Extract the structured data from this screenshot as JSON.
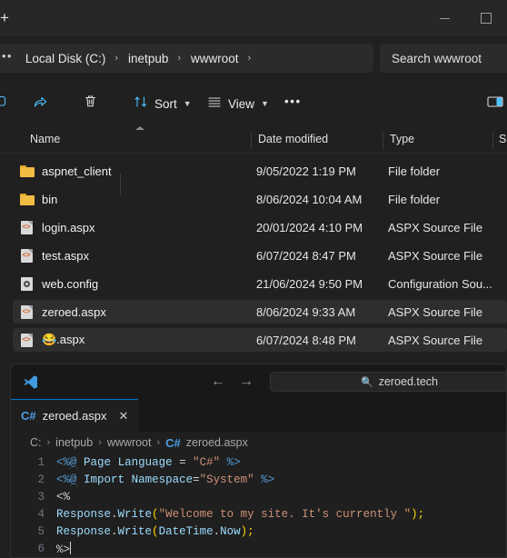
{
  "colors": {
    "accent": "#0078d4",
    "explorer_bg": "#202020",
    "titlebar_bg": "#272727",
    "vscode_bg": "#1f1f1f",
    "selected_row": "#2e2e2e",
    "folder_yellow": "#f2bb42",
    "aspx_orange": "#d4622a"
  },
  "explorer": {
    "titlebar": {
      "new_tab_label": "+",
      "minimize_label": "minimize",
      "maximize_label": "maximize"
    },
    "address_bar": {
      "overflow_label": "•••",
      "crumbs": [
        {
          "label": "Local Disk (C:)"
        },
        {
          "label": "inetpub"
        },
        {
          "label": "wwwroot"
        }
      ],
      "separator": "›",
      "trailing_separator": "›"
    },
    "search": {
      "value": "Search wwwroot",
      "placeholder": "Search wwwroot"
    },
    "toolbar": {
      "items": [
        {
          "name": "rename-button",
          "label": ""
        },
        {
          "name": "share-button",
          "label": ""
        },
        {
          "name": "delete-button",
          "label": ""
        },
        {
          "name": "sort-button",
          "label": "Sort"
        },
        {
          "name": "view-button",
          "label": "View"
        },
        {
          "name": "more-button",
          "label": "•••"
        },
        {
          "name": "details-pane-button",
          "label": ""
        }
      ],
      "sort_label": "Sort",
      "view_label": "View",
      "more_label": "•••"
    },
    "columns": [
      {
        "key": "name",
        "label": "Name",
        "sorted": "asc"
      },
      {
        "key": "date",
        "label": "Date modified"
      },
      {
        "key": "type",
        "label": "Type"
      },
      {
        "key": "size",
        "label": "Si"
      }
    ],
    "rows": [
      {
        "icon": "folder-icon",
        "name": "aspnet_client",
        "date": "9/05/2022 1:19 PM",
        "type": "File folder",
        "selected": false
      },
      {
        "icon": "folder-icon",
        "name": "bin",
        "date": "8/06/2024 10:04 AM",
        "type": "File folder",
        "selected": false
      },
      {
        "icon": "aspx-file-icon",
        "name": "login.aspx",
        "date": "20/01/2024 4:10 PM",
        "type": "ASPX Source File",
        "selected": false
      },
      {
        "icon": "aspx-file-icon",
        "name": "test.aspx",
        "date": "6/07/2024 8:47 PM",
        "type": "ASPX Source File",
        "selected": false
      },
      {
        "icon": "config-file-icon",
        "name": "web.config",
        "date": "21/06/2024 9:50 PM",
        "type": "Configuration Sou...",
        "selected": false
      },
      {
        "icon": "aspx-file-icon",
        "name": "zeroed.aspx",
        "date": "8/06/2024 9:33 AM",
        "type": "ASPX Source File",
        "selected": true
      },
      {
        "icon": "aspx-file-icon",
        "name": "😂.aspx",
        "date": "6/07/2024 8:48 PM",
        "type": "ASPX Source File",
        "selected": true
      }
    ]
  },
  "vscode": {
    "title_bar": {
      "back_label": "←",
      "forward_label": "→",
      "search_value": "zeroed.tech",
      "search_placeholder": "zeroed.tech"
    },
    "tab": {
      "icon_label": "C#",
      "label": "zeroed.aspx",
      "close_label": "✕"
    },
    "breadcrumb": {
      "parts": [
        "C:",
        "inetpub",
        "wwwroot"
      ],
      "file_icon_label": "C#",
      "file_label": "zeroed.aspx",
      "separator": "›"
    },
    "editor": {
      "line_numbers": [
        "1",
        "2",
        "3",
        "4",
        "5",
        "6"
      ],
      "lines": [
        "<%@ Page Language = \"C#\" %>",
        "<%@ Import Namespace=\"System\" %>",
        "<%",
        "Response.Write(\"Welcome to my site. It's currently \");",
        "Response.Write(DateTime.Now);",
        "%>"
      ]
    }
  }
}
